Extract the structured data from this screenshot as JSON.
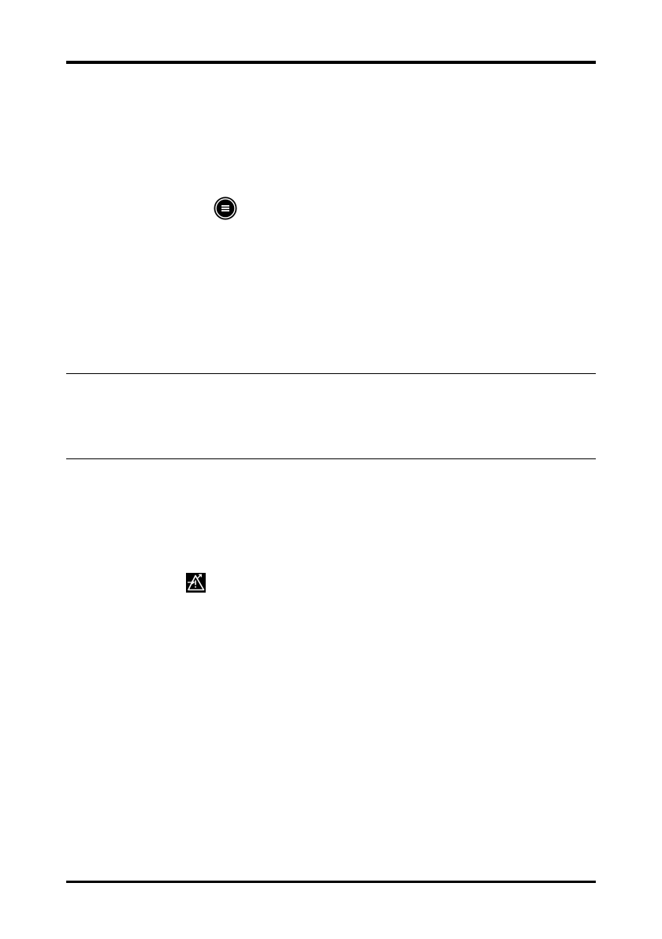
{
  "page": {
    "background_color": "#ffffff",
    "rule_color": "#000000"
  },
  "icons": [
    {
      "name": "main-menu-icon",
      "fill": "#000000",
      "glyph": "three-horizontal-lines"
    },
    {
      "name": "alarm-setup-icon",
      "fill": "#000000",
      "glyph": "warning-triangle-with-arrow"
    }
  ]
}
